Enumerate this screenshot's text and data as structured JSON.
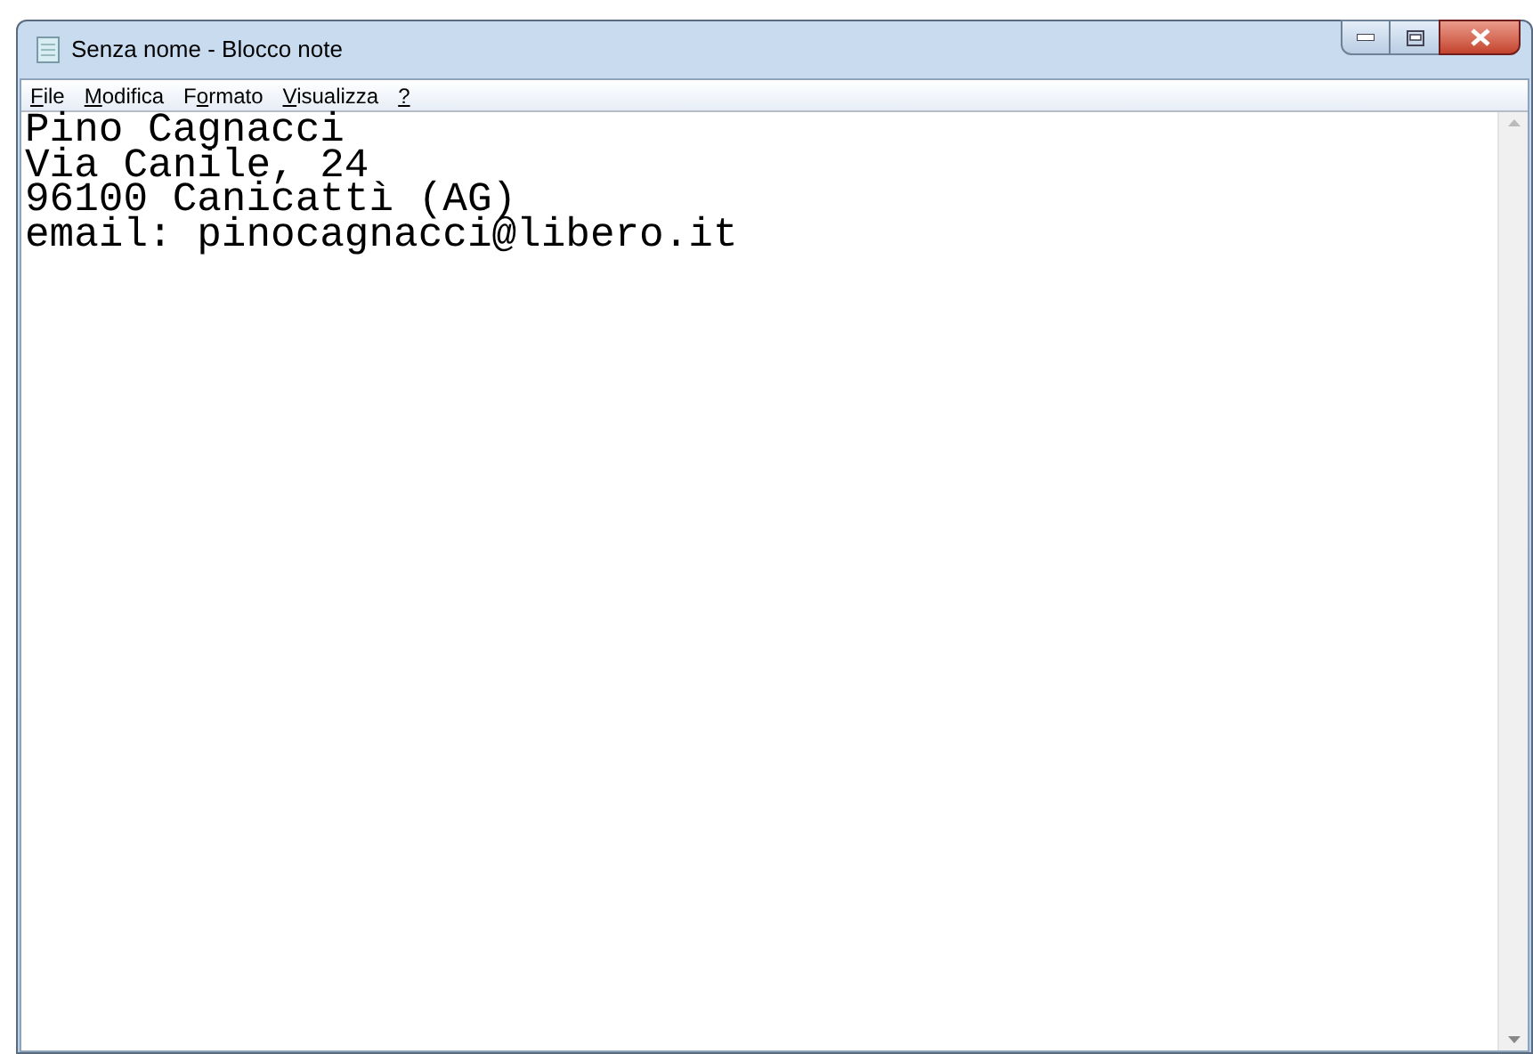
{
  "window": {
    "title": "Senza nome - Blocco note"
  },
  "menu": [
    {
      "key": "F",
      "after": "ile"
    },
    {
      "key": "M",
      "after": "odifica"
    },
    {
      "before": "F",
      "key": "o",
      "after": "rmato"
    },
    {
      "key": "V",
      "after": "isualizza"
    },
    {
      "key": "?"
    }
  ],
  "editor": {
    "lines": [
      "Pino Cagnacci",
      "Via Canile, 24",
      "96100 Canicattì (AG)",
      "email: pinocagnacci@libero.it"
    ]
  }
}
